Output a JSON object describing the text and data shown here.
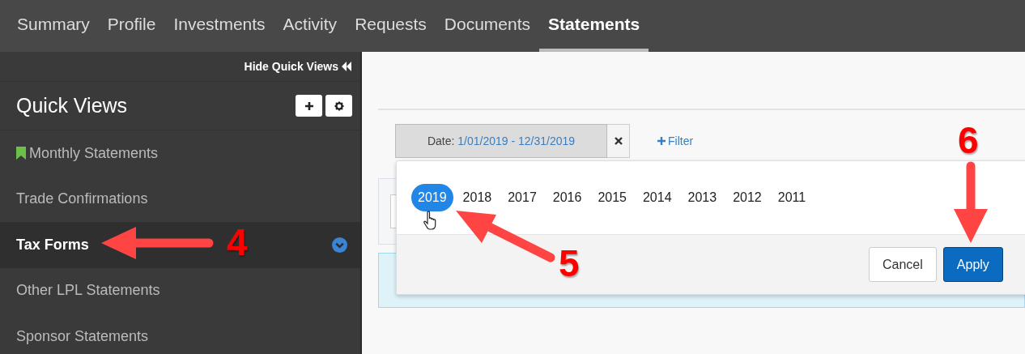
{
  "nav": {
    "tabs": [
      {
        "label": "Summary",
        "selected": false
      },
      {
        "label": "Profile",
        "selected": false
      },
      {
        "label": "Investments",
        "selected": false
      },
      {
        "label": "Activity",
        "selected": false
      },
      {
        "label": "Requests",
        "selected": false
      },
      {
        "label": "Documents",
        "selected": false
      },
      {
        "label": "Statements",
        "selected": true
      }
    ]
  },
  "sidebar": {
    "hide_link": "Hide Quick Views",
    "title": "Quick Views",
    "items": [
      {
        "label": "Monthly Statements",
        "selected": false,
        "bookmarked": true
      },
      {
        "label": "Trade Confirmations",
        "selected": false,
        "bookmarked": false
      },
      {
        "label": "Tax Forms",
        "selected": true,
        "bookmarked": false
      },
      {
        "label": "Other LPL Statements",
        "selected": false,
        "bookmarked": false
      },
      {
        "label": "Sponsor Statements",
        "selected": false,
        "bookmarked": false
      }
    ]
  },
  "filter": {
    "date_label": "Date:",
    "date_value": "1/01/2019 - 12/31/2019",
    "add_filter": "Filter"
  },
  "year_picker": {
    "years": [
      {
        "label": "2019",
        "selected": true
      },
      {
        "label": "2018",
        "selected": false
      },
      {
        "label": "2017",
        "selected": false
      },
      {
        "label": "2016",
        "selected": false
      },
      {
        "label": "2015",
        "selected": false
      },
      {
        "label": "2014",
        "selected": false
      },
      {
        "label": "2013",
        "selected": false
      },
      {
        "label": "2012",
        "selected": false
      },
      {
        "label": "2011",
        "selected": false
      }
    ],
    "buttons": [
      {
        "label": "Cancel",
        "kind": "secondary"
      },
      {
        "label": "Apply",
        "kind": "primary"
      }
    ]
  },
  "annotations": [
    {
      "label": "4"
    },
    {
      "label": "5"
    },
    {
      "label": "6"
    }
  ]
}
